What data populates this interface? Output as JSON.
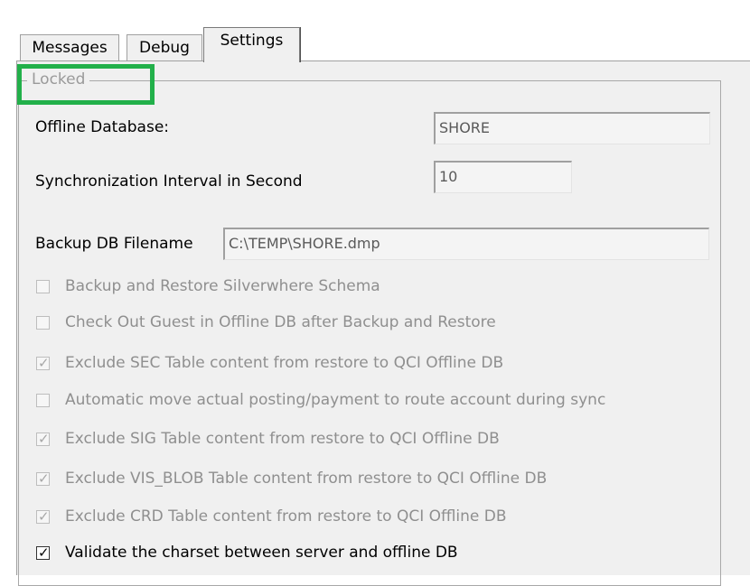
{
  "tabs": [
    {
      "label": "Messages",
      "active": false
    },
    {
      "label": "Debug",
      "active": false
    },
    {
      "label": "Settings",
      "active": true
    }
  ],
  "group": {
    "legend": "Locked"
  },
  "fields": {
    "offline_db_label": "Offline Database:",
    "offline_db_value": "SHORE",
    "sync_interval_label": "Synchronization Interval  in Second",
    "sync_interval_value": "10",
    "backup_file_label": "Backup DB Filename",
    "backup_file_value": "C:\\TEMP\\SHORE.dmp"
  },
  "checkboxes": [
    {
      "label": "Backup and Restore Silverwhere Schema",
      "checked": false,
      "enabled": false
    },
    {
      "label": "Check Out Guest in Offline DB after Backup and Restore",
      "checked": false,
      "enabled": false
    },
    {
      "label": "Exclude SEC Table content from restore to QCI Offline DB",
      "checked": true,
      "enabled": false
    },
    {
      "label": "Automatic move actual posting/payment to route account during sync",
      "checked": false,
      "enabled": false
    },
    {
      "label": "Exclude SIG Table content from restore to QCI Offline DB",
      "checked": true,
      "enabled": false
    },
    {
      "label": "Exclude VIS_BLOB Table content from restore to QCI Offline DB",
      "checked": true,
      "enabled": false
    },
    {
      "label": "Exclude CRD Table content from restore to QCI Offline DB",
      "checked": true,
      "enabled": false
    },
    {
      "label": "Validate the charset between server and offline DB",
      "checked": true,
      "enabled": true
    }
  ],
  "checkmark_glyph": "✓",
  "colors": {
    "highlight": "#22b04a",
    "panel": "#f0f0f0",
    "disabled_text": "#8f8f8f"
  }
}
